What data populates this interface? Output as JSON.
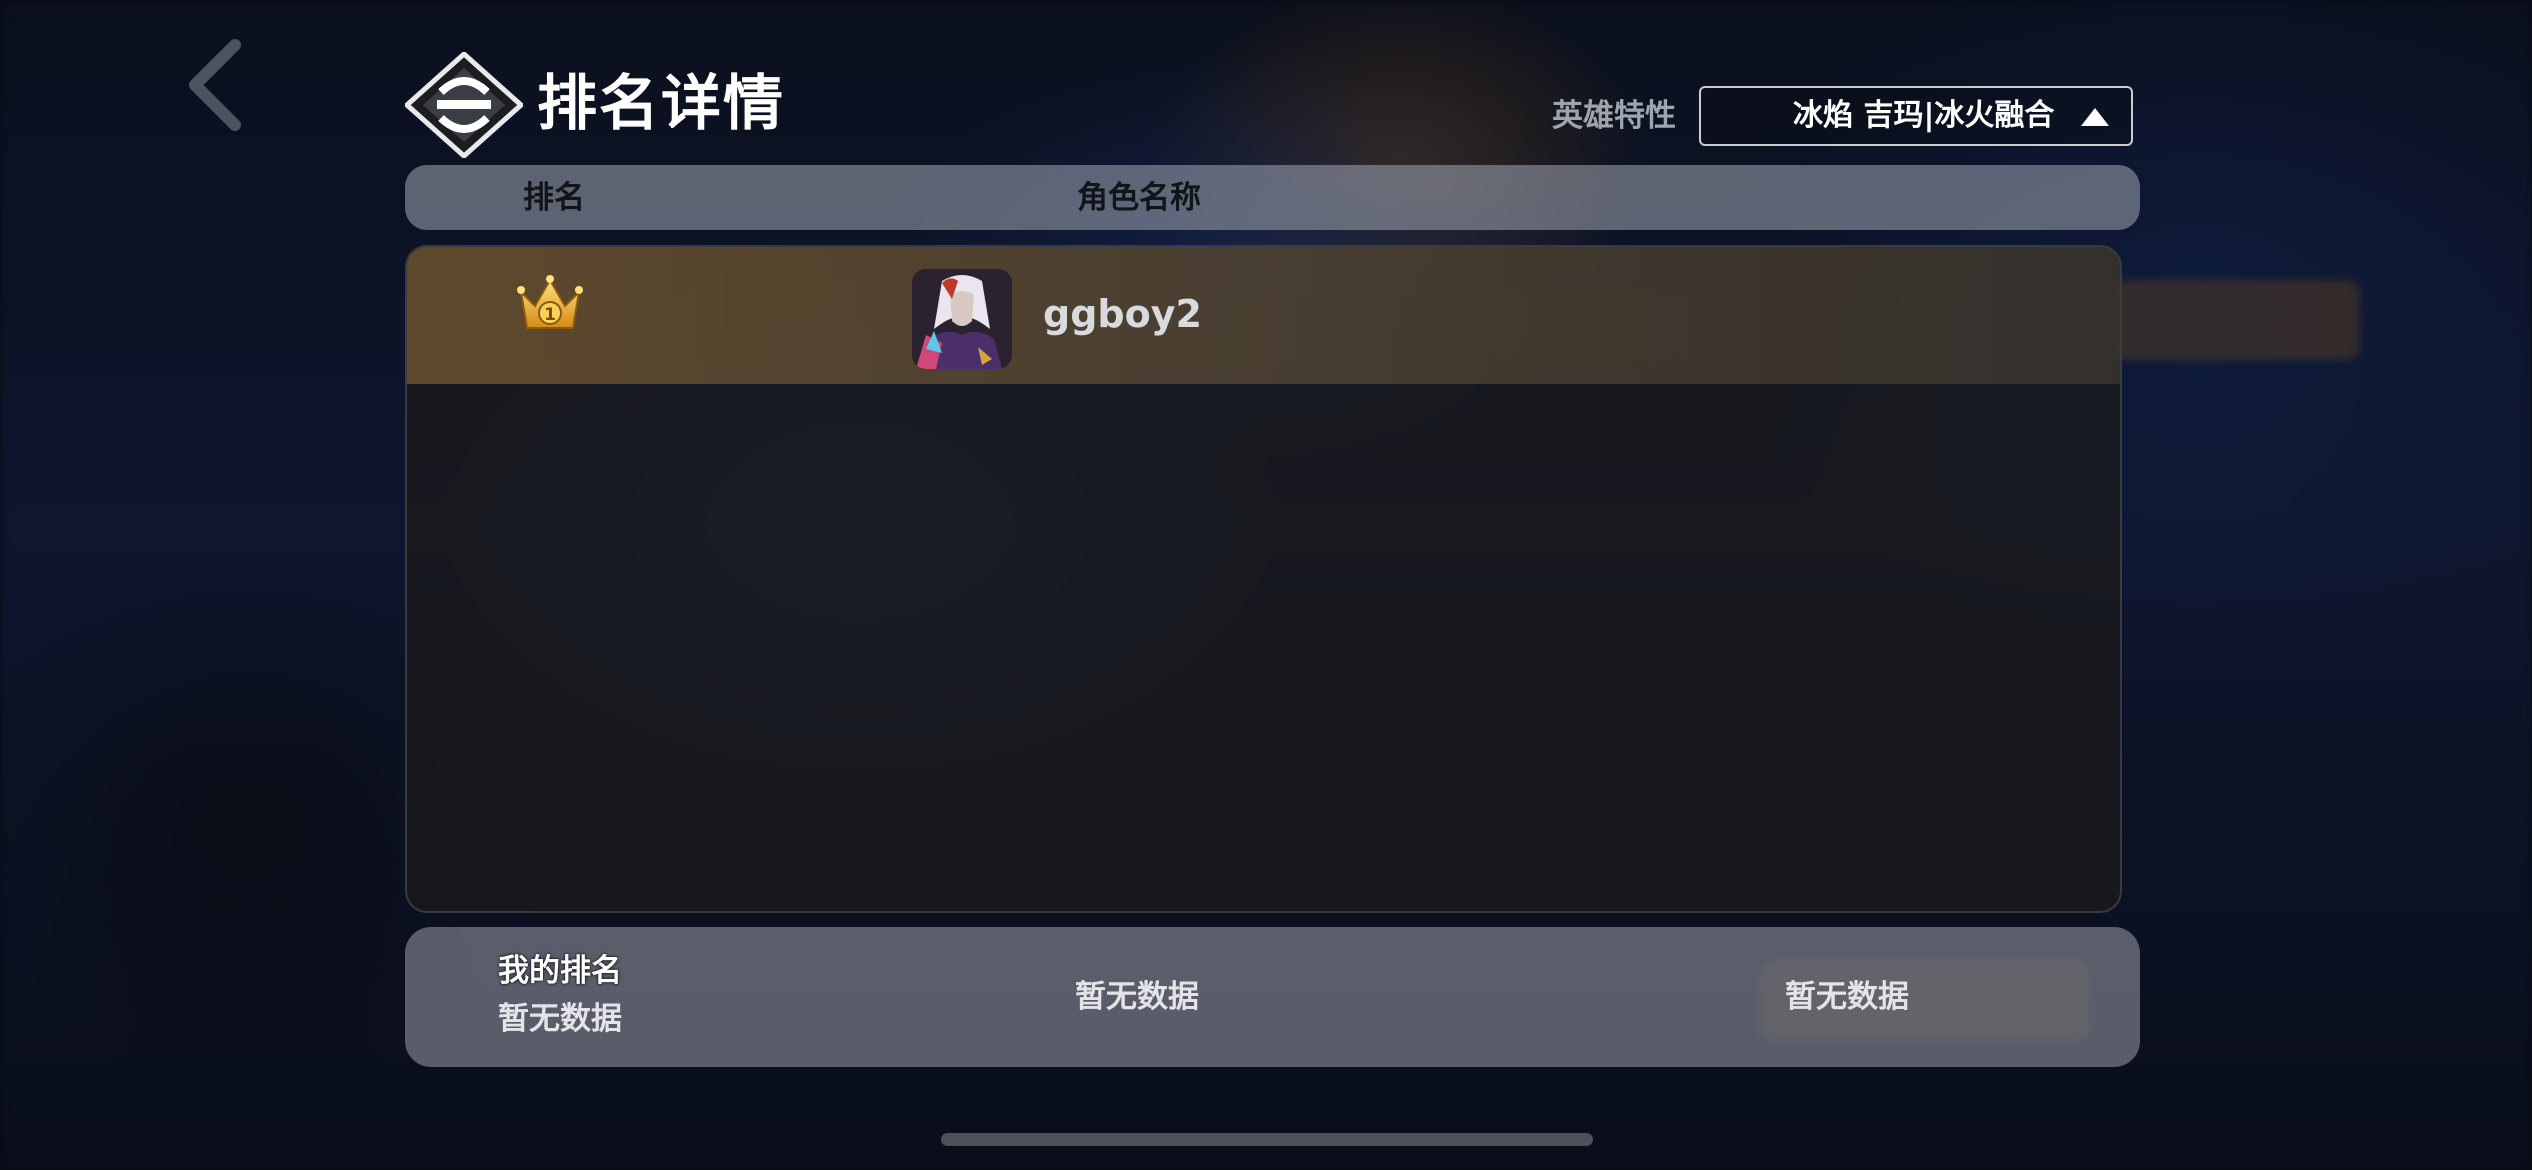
{
  "header": {
    "title": "排名详情",
    "logo_icon": "ranking-emblem-icon",
    "back_icon": "chevron-left-icon"
  },
  "filter": {
    "label": "英雄特性",
    "selected": "冰焰 吉玛|冰火融合",
    "caret_icon": "triangle-up-icon"
  },
  "table": {
    "columns": {
      "rank": "排名",
      "name": "角色名称"
    },
    "rows": [
      {
        "rank": "1",
        "rank_icon": "crown-icon",
        "avatar_icon": "character-avatar",
        "name": "ggboy2"
      }
    ]
  },
  "footer": {
    "my_rank_label": "我的排名",
    "my_rank_value": "暂无数据",
    "middle_value": "暂无数据",
    "right_value": "暂无数据"
  },
  "colors": {
    "first_row_accent": "#7a5a32",
    "crown_gold": "#f2b632"
  }
}
